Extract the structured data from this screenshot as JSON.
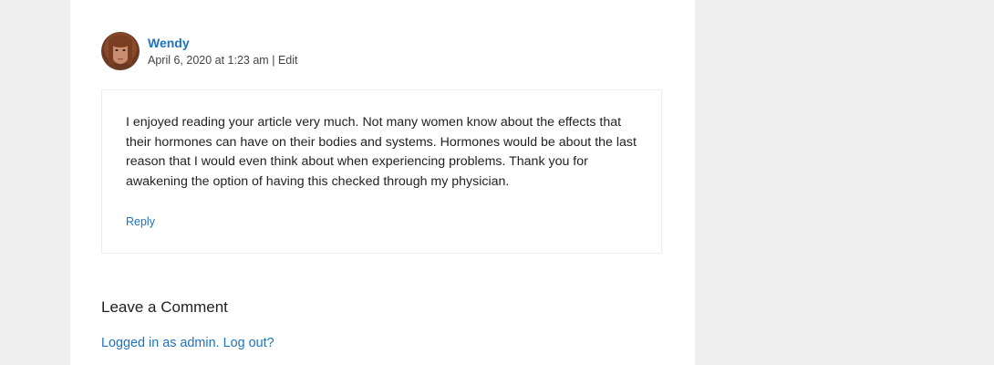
{
  "comment": {
    "author": "Wendy",
    "date": "April 6, 2020 at 1:23 am",
    "separator": "|",
    "edit_label": "Edit",
    "text": "I enjoyed reading your article very much. Not many women know about the effects that their hormones can have on their bodies and systems. Hormones would be about the last reason that I would even think about when experiencing problems. Thank you for awakening the option of having this checked through my physician.",
    "reply_label": "Reply"
  },
  "respond": {
    "title": "Leave a Comment",
    "logged_in_text": "Logged in as admin.",
    "logout_label": "Log out?"
  },
  "colors": {
    "background": "#efefef",
    "card": "#ffffff",
    "link": "#1e73be",
    "text": "#222222"
  }
}
